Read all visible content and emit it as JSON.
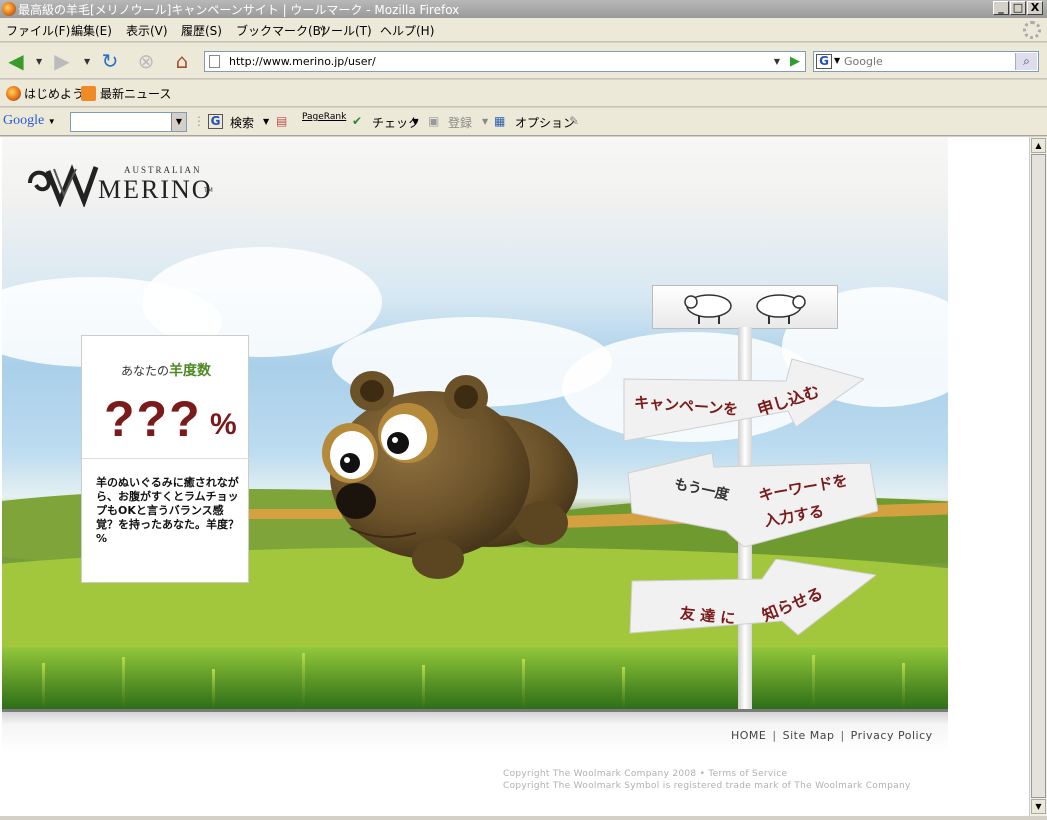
{
  "window": {
    "title": "最高級の羊毛[メリノウール]キャンペーンサイト | ウールマーク - Mozilla Firefox",
    "controls": [
      "_",
      "□",
      "X"
    ]
  },
  "menu": [
    "ファイル(F)",
    "編集(E)",
    "表示(V)",
    "履歴(S)",
    "ブックマーク(B)",
    "ツール(T)",
    "ヘルプ(H)"
  ],
  "nav": {
    "url": "http://www.merino.jp/user/",
    "search_engine": "G",
    "search_placeholder": "Google"
  },
  "bookmarks": [
    "はじめよう",
    "最新ニュース"
  ],
  "google_toolbar": {
    "logo": "Google",
    "search_label": "検索",
    "pagerank": "PageRank",
    "check": "チェック",
    "register": "登録",
    "options": "オプション"
  },
  "page": {
    "logo": {
      "small": "AUSTRALIAN",
      "big": "MERINO",
      "tm": "TM"
    },
    "score": {
      "heading_prefix": "あなたの",
      "heading_em": "羊度数",
      "value": "???",
      "unit": "%",
      "description": "羊のぬいぐるみに癒されながら、お腹がすくとラムチョップもOKと言うバランス感覚？を持ったあなた。羊度？%"
    },
    "signs": {
      "apply_left": "キャンペーンを",
      "apply_right": "申し込む",
      "again_left": "もう一度",
      "again_right_1": "キーワードを",
      "again_right_2": "入力する",
      "tell_left": "友 達 に",
      "tell_right": "知らせる"
    },
    "footer": {
      "home": "HOME",
      "sitemap": "Site Map",
      "privacy": "Privacy Policy",
      "sep": "|",
      "copyright1": "Copyright The Woolmark Company 2008 • Terms of Service",
      "copyright2": "Copyright The Woolmark Symbol is registered trade mark of The Woolmark Company"
    }
  },
  "colors": {
    "accent_red": "#7a1a1a",
    "accent_green": "#4e8a24"
  }
}
